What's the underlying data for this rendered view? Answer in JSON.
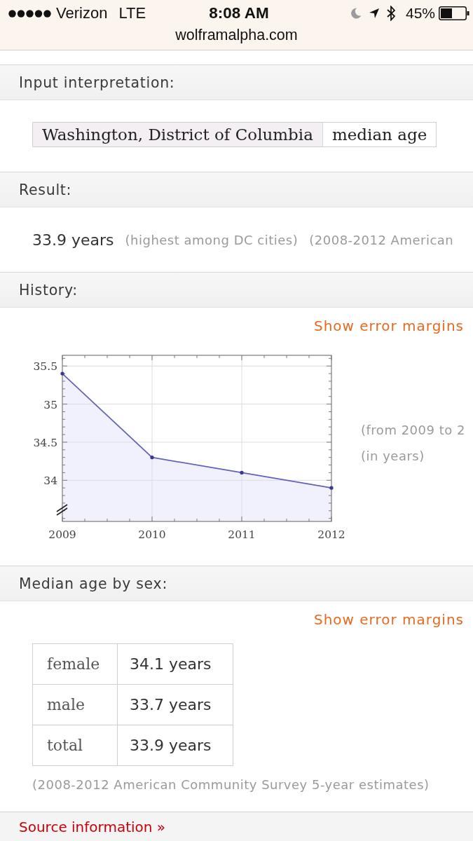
{
  "status_bar": {
    "carrier": "Verizon",
    "network": "LTE",
    "time": "8:08 AM",
    "battery": "45%",
    "url": "wolframalpha.com"
  },
  "input_interpretation": {
    "title": "Input interpretation:",
    "cells": [
      {
        "kind": "entity",
        "text": "Washington, District of Columbia"
      },
      {
        "kind": "property",
        "text": "median age"
      }
    ]
  },
  "result": {
    "title": "Result:",
    "value": "33.9 years",
    "notes": [
      "(highest among DC cities)",
      "(2008-2012 American"
    ]
  },
  "history": {
    "title": "History:",
    "link": "Show error margins",
    "chart_data": {
      "type": "area",
      "categories": [
        "2009",
        "2010",
        "2011",
        "2012"
      ],
      "values": [
        35.4,
        34.3,
        34.1,
        33.9
      ],
      "ylim": [
        33.46,
        35.64
      ],
      "yticks": [
        34,
        34.5,
        35,
        35.5
      ],
      "grid": true
    },
    "notes": [
      "(from 2009 to 2",
      "(in years)"
    ]
  },
  "median_age_by_sex": {
    "title": "Median age by sex:",
    "link": "Show error margins",
    "rows": [
      {
        "label": "female",
        "value": "34.1 years"
      },
      {
        "label": "male",
        "value": "33.7 years"
      },
      {
        "label": "total",
        "value": "33.9 years"
      }
    ],
    "footnote": "(2008-2012 American Community Survey 5-year estimates)"
  },
  "source_link": "Source information »"
}
